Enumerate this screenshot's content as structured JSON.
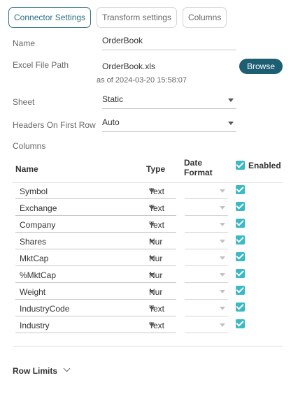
{
  "tabs": [
    {
      "label": "Connector Settings",
      "active": true
    },
    {
      "label": "Transform settings",
      "active": false
    },
    {
      "label": "Columns",
      "active": false
    }
  ],
  "form": {
    "name_label": "Name",
    "name_value": "OrderBook",
    "path_label": "Excel File Path",
    "path_value": "OrderBook.xls",
    "browse_label": "Browse",
    "as_of": "as of 2024-03-20 15:58:07",
    "sheet_label": "Sheet",
    "sheet_value": "Static",
    "headers_label": "Headers On First Row",
    "headers_value": "Auto",
    "columns_label": "Columns"
  },
  "columns_table": {
    "headers": {
      "name": "Name",
      "type": "Type",
      "date_line1": "Date",
      "date_line2": "Format",
      "enabled": "Enabled"
    },
    "rows": [
      {
        "name": "Symbol",
        "type": "Text",
        "enabled": true
      },
      {
        "name": "Exchange",
        "type": "Text",
        "enabled": true
      },
      {
        "name": "Company",
        "type": "Text",
        "enabled": true
      },
      {
        "name": "Shares",
        "type": "Nur",
        "enabled": true
      },
      {
        "name": "MktCap",
        "type": "Nur",
        "enabled": true
      },
      {
        "name": "%MktCap",
        "type": "Nur",
        "enabled": true
      },
      {
        "name": "Weight",
        "type": "Nur",
        "enabled": true
      },
      {
        "name": "IndustryCode",
        "type": "Text",
        "enabled": true
      },
      {
        "name": "Industry",
        "type": "Text",
        "enabled": true
      }
    ]
  },
  "row_limits_label": "Row Limits",
  "colors": {
    "accent": "#2a6f82",
    "browse_bg": "#1d5e73",
    "checkbox": "#3ab9c6"
  }
}
